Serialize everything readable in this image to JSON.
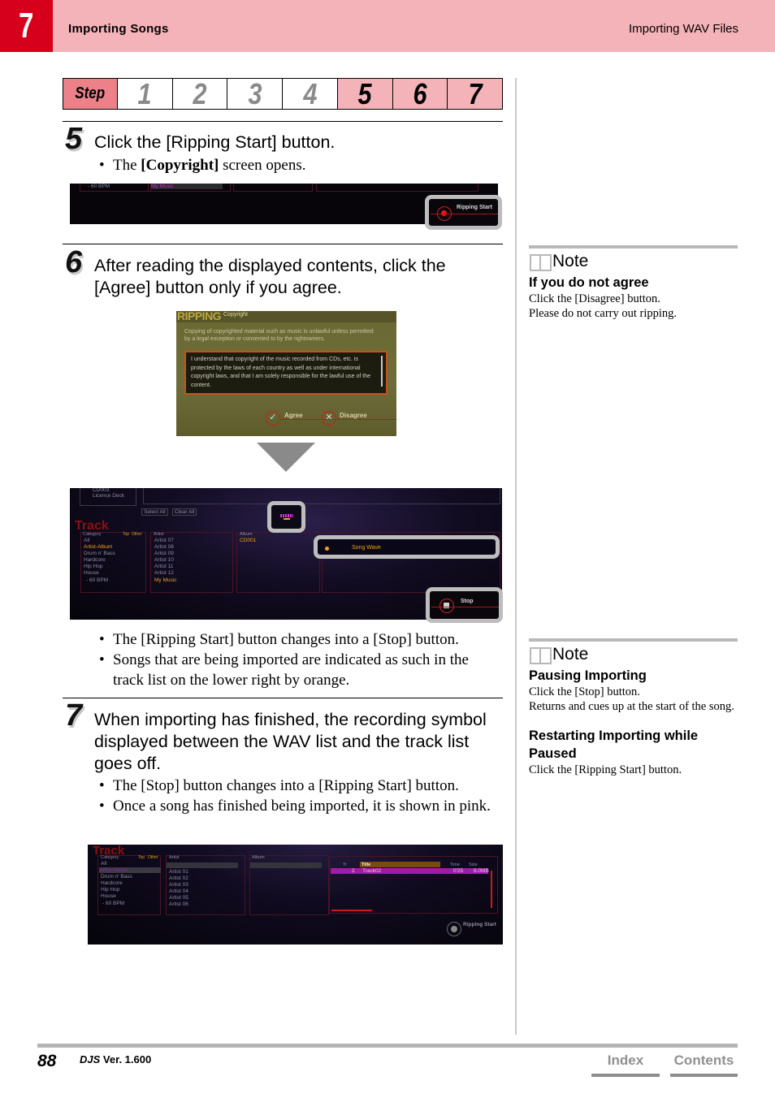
{
  "header": {
    "chapter_number": "7",
    "chapter_title": "Importing Songs",
    "section_title": "Importing WAV Files"
  },
  "stepbar": {
    "label": "Step",
    "steps": [
      "1",
      "2",
      "3",
      "4",
      "5",
      "6",
      "7"
    ],
    "active_steps": [
      "5",
      "6",
      "7"
    ]
  },
  "steps": [
    {
      "number": "5",
      "text": "Click the [Ripping Start] button.",
      "bullets_html": [
        "The ",
        "[Copyright]",
        " screen opens."
      ],
      "screen": {
        "category_item": "- 60 BPM",
        "artist_item": "My Music",
        "button_label": "Ripping Start"
      }
    },
    {
      "number": "6",
      "text": "After reading the displayed contents, click the [Agree] button only if you agree.",
      "dialog": {
        "logo": "RIPPING",
        "title": "Copyright",
        "intro": "Copying of copyrighted material such as music is unlawful unless permitted by a legal exception or consented to by the rightowners.",
        "body": "I understand that copyright of the music recorded from CDs, etc. is protected by the laws of each country as well as under international copyright laws, and that I am solely responsible for the lawful use of the content.",
        "agree_label": "Agree",
        "disagree_label": "Disagree"
      },
      "screen2": {
        "folders": [
          "CD003",
          "Licence Deck"
        ],
        "select_all": "Select All",
        "clear_all": "Clear All",
        "track_label": "Track",
        "category_header": "Category",
        "category_tabs": [
          "Top",
          "Other"
        ],
        "categories": [
          "All",
          "Artist-Album",
          "Drum n' Bass",
          "Hardcore",
          "Hip Hop",
          "House",
          "- 60 BPM"
        ],
        "selected_category": "Artist-Album",
        "artist_header": "Artist",
        "artists": [
          "Artist 07",
          "Artist 08",
          "Artist 09",
          "Artist 10",
          "Artist 11",
          "Artist 12",
          "My Music"
        ],
        "selected_artist": "My Music",
        "album_header": "Album",
        "albums": [
          "CD001"
        ],
        "importing_song": "Song Wave",
        "stop_label": "Stop"
      },
      "bullets": [
        "The [Ripping Start] button changes into a [Stop] button.",
        "Songs that are being imported are indicated as such in the track list on the lower right by orange."
      ]
    },
    {
      "number": "7",
      "text": "When importing has finished, the recording symbol displayed between the WAV list and the track list goes off.",
      "bullets": [
        "The [Stop] button changes into a [Ripping Start] button.",
        "Once a song has finished being imported, it is shown in pink."
      ],
      "screen": {
        "track_label": "Track",
        "category_header": "Category",
        "category_tabs": [
          "Top",
          "Other"
        ],
        "categories": [
          "All",
          "Artist-Album",
          "Drum n' Bass",
          "Hardcore",
          "Hip Hop",
          "House",
          "- 60 BPM"
        ],
        "artist_header": "Artist",
        "artists": [
          "Artist 01",
          "Artist 02",
          "Artist 03",
          "Artist 04",
          "Artist 05",
          "Artist 06"
        ],
        "album_header": "Album",
        "track_columns": [
          "Tr",
          "Title",
          "Time",
          "Size"
        ],
        "track_row": {
          "tr": "2",
          "title": "Track02",
          "time": "0'25",
          "size": "6.0MB"
        },
        "button_label": "Ripping Start"
      }
    }
  ],
  "notes": [
    {
      "title": "Note",
      "sections": [
        {
          "heading": "If you do not agree",
          "lines": [
            "Click the [Disagree] button.",
            "Please do not carry out ripping."
          ]
        }
      ]
    },
    {
      "title": "Note",
      "sections": [
        {
          "heading": "Pausing Importing",
          "lines": [
            "Click the [Stop] button.",
            "Returns and cues up at the start of the song."
          ]
        },
        {
          "heading": "Restarting Importing while Paused",
          "lines": [
            "Click the [Ripping Start] button."
          ]
        }
      ]
    }
  ],
  "footer": {
    "page_number": "88",
    "product": "DJS",
    "version": "Ver. 1.600",
    "index_label": "Index",
    "contents_label": "Contents"
  },
  "colors": {
    "header_pink": "#f4b3b8",
    "chapter_red": "#d6001c",
    "step_label": "#ec818a",
    "importing_orange": "#f0a020",
    "imported_pink": "#a020a0"
  }
}
